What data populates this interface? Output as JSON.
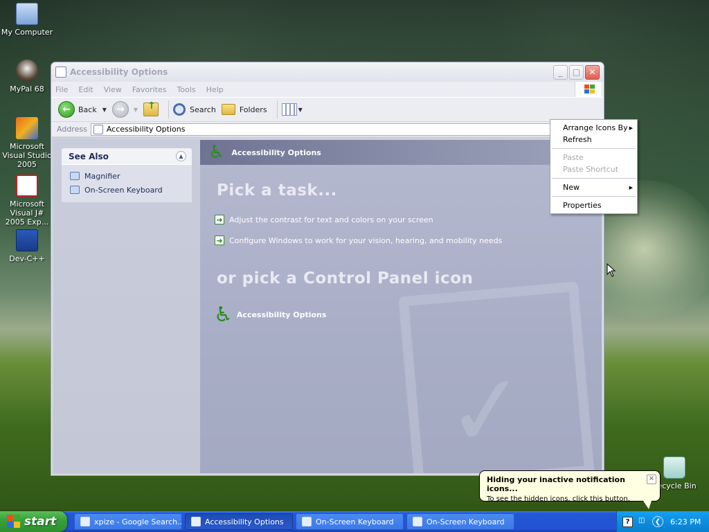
{
  "desktop": {
    "icons": [
      {
        "label": "My Computer"
      },
      {
        "label": "MyPal 68"
      },
      {
        "label": "Microsoft Visual Studio 2005"
      },
      {
        "label": "Microsoft Visual J# 2005 Exp..."
      },
      {
        "label": "Dev-C++"
      },
      {
        "label": "Recycle Bin"
      }
    ]
  },
  "window": {
    "title": "Accessibility Options",
    "menu": [
      "File",
      "Edit",
      "View",
      "Favorites",
      "Tools",
      "Help"
    ],
    "toolbar": {
      "back": "Back",
      "search": "Search",
      "folders": "Folders"
    },
    "address": {
      "label": "Address",
      "value": "Accessibility Options"
    },
    "see_also": {
      "title": "See Also",
      "links": [
        "Magnifier",
        "On-Screen Keyboard"
      ]
    },
    "banner": "Accessibility Options",
    "pick_task": "Pick a task...",
    "tasks": [
      "Adjust the contrast for text and colors on your screen",
      "Configure Windows to work for your vision, hearing, and mobility needs"
    ],
    "or_pick": "or pick a Control Panel icon",
    "cp_icon": "Accessibility Options"
  },
  "context_menu": {
    "items": [
      {
        "label": "Arrange Icons By",
        "submenu": true,
        "disabled": false
      },
      {
        "label": "Refresh",
        "submenu": false,
        "disabled": false
      },
      {
        "label": "Paste",
        "submenu": false,
        "disabled": true
      },
      {
        "label": "Paste Shortcut",
        "submenu": false,
        "disabled": true
      },
      {
        "label": "New",
        "submenu": true,
        "disabled": false
      },
      {
        "label": "Properties",
        "submenu": false,
        "disabled": false
      }
    ]
  },
  "balloon": {
    "title": "Hiding your inactive notification icons...",
    "body": "To see the hidden icons, click this button."
  },
  "taskbar": {
    "start": "start",
    "tasks": [
      {
        "label": "xpize - Google Search...",
        "active": false
      },
      {
        "label": "Accessibility Options",
        "active": true
      },
      {
        "label": "On-Screen Keyboard",
        "active": false
      },
      {
        "label": "On-Screen Keyboard",
        "active": false
      }
    ],
    "tray_help": "?",
    "clock": "6:23 PM"
  },
  "colors": {
    "taskbar_blue": "#2458d6",
    "start_green": "#39a239",
    "tray_blue": "#0d8ee0",
    "balloon_bg": "#ffffe1"
  }
}
